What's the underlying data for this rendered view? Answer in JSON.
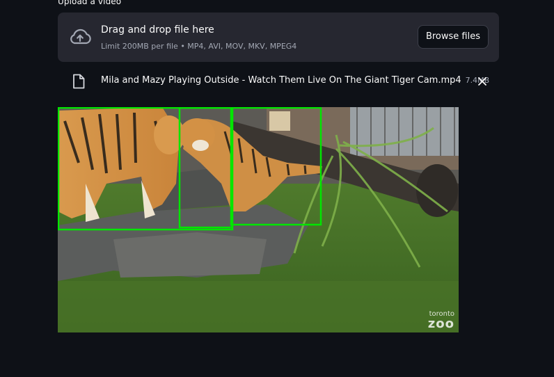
{
  "uploader": {
    "label": "Upload a video",
    "dropzone_title": "Drag and drop file here",
    "dropzone_sub": "Limit 200MB per file • MP4, AVI, MOV, MKV, MPEG4",
    "browse_label": "Browse files"
  },
  "file": {
    "name": "Mila and Mazy Playing Outside - Watch Them Live On The Giant Tiger Cam.mp4",
    "size": "7.4MB"
  },
  "video": {
    "watermark_line1": "toronto",
    "watermark_line2": "zoo",
    "detection_box_color": "#00e600"
  },
  "icons": {
    "cloud": "cloud-upload-icon",
    "file": "file-icon",
    "close": "close-icon"
  },
  "colors": {
    "background": "#0e1117",
    "dropzone": "#262730",
    "muted_text": "#a3a8b4"
  }
}
